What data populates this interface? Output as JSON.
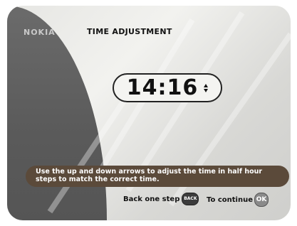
{
  "header": {
    "brand": "NOKIA",
    "title": "TIME ADJUSTMENT"
  },
  "time_display": {
    "value": "14:16"
  },
  "instructions": {
    "text": "Use the up and down arrows to adjust the time in half hour steps to match the correct time."
  },
  "footer": {
    "back_label": "Back one step",
    "back_key": "BACK",
    "continue_label": "To continue",
    "ok_key": "OK"
  },
  "icons": {
    "up": "arrow-up-icon",
    "down": "arrow-down-icon"
  },
  "colors": {
    "info_bar": "#5b4a3a",
    "left_panel": "#5a5a5a",
    "background": "#e6e6e3"
  }
}
